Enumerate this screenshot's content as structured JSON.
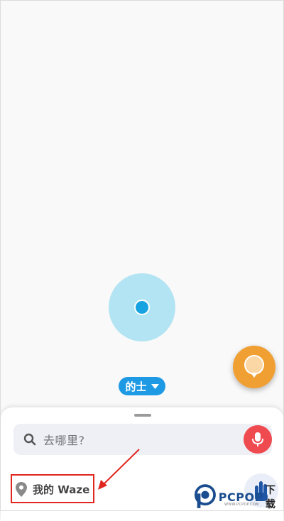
{
  "mode": {
    "label": "的士"
  },
  "search": {
    "placeholder": "去哪里?"
  },
  "my_waze": {
    "label": "我的 Waze"
  },
  "watermark": {
    "brand": "PCPOP",
    "suffix": "下载",
    "tagline": "WWW.PCPOP.COM"
  },
  "colors": {
    "accent_blue": "#1e9ae5",
    "location_halo": "#b3e4f3",
    "fab_orange": "#f0a033",
    "mic_red": "#ee4a4f",
    "annotation_red": "#e0261f"
  },
  "icons": {
    "search": "search-icon",
    "mic": "microphone-icon",
    "pin": "location-pin-icon",
    "report": "report-bubble-icon",
    "dropdown": "chevron-down-icon"
  }
}
